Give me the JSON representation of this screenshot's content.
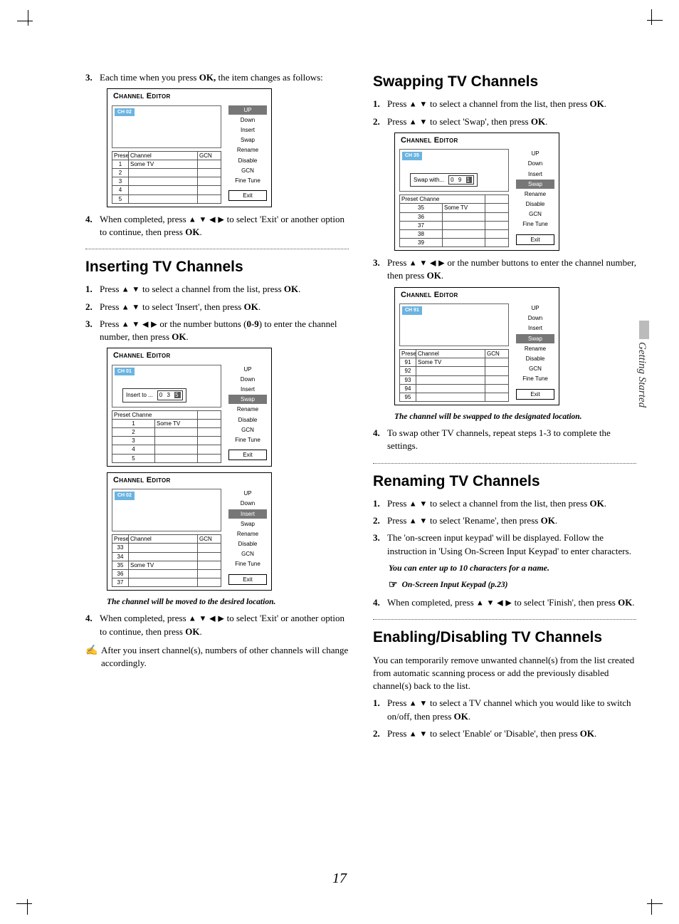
{
  "pageNumber": "17",
  "sideTab": "Getting Started",
  "panelTitle": "Channel Editor",
  "tableHeaders": {
    "preset": "Preset",
    "channel": "Channel",
    "gcn": "GCN"
  },
  "menuItems": [
    "UP",
    "Down",
    "Insert",
    "Swap",
    "Rename",
    "Disable",
    "GCN",
    "Fine Tune"
  ],
  "exitLabel": "Exit",
  "leftCol": {
    "step3": {
      "num": "3.",
      "text_a": "Each time when you press ",
      "ok": "OK,",
      "text_b": "  the item changes as follows:"
    },
    "panel1": {
      "chBadge": "CH 02",
      "rows": [
        [
          "1",
          "Some TV",
          ""
        ],
        [
          "2",
          "",
          ""
        ],
        [
          "3",
          "",
          ""
        ],
        [
          "4",
          "",
          ""
        ],
        [
          "5",
          "",
          ""
        ]
      ],
      "highlight": 0
    },
    "step4": {
      "num": "4.",
      "text_a": "When completed, press ",
      "arrows": "▲ ▼ ◀ ▶",
      "text_b": " to select 'Exit' or another option to continue, then press ",
      "ok": "OK",
      "dot": "."
    },
    "insertingTitle": "Inserting TV Channels",
    "ins_step1": {
      "num": "1.",
      "text_a": "Press ",
      "arrows": "▲ ▼",
      "text_b": " to select a channel from the list, press ",
      "ok": "OK",
      "dot": "."
    },
    "ins_step2": {
      "num": "2.",
      "text_a": "Press ",
      "arrows": "▲ ▼",
      "text_b": " to select 'Insert', then press ",
      "ok": "OK",
      "dot": "."
    },
    "ins_step3": {
      "num": "3.",
      "text_a": "Press ",
      "arrows": "▲ ▼ ◀ ▶",
      "text_b": " or the number buttons (",
      "range": "0-9",
      "text_c": ") to enter the channel number, then press ",
      "ok": "OK",
      "dot": "."
    },
    "panel2": {
      "chBadge": "CH 01",
      "popupLabel": "Insert to ...",
      "popupDigits": [
        "0",
        "3",
        "5"
      ],
      "rows": [
        [
          "1",
          "Some TV",
          ""
        ],
        [
          "2",
          "",
          ""
        ],
        [
          "3",
          "",
          ""
        ],
        [
          "4",
          "",
          ""
        ],
        [
          "5",
          "",
          ""
        ]
      ],
      "highlight": 3,
      "tableHeaderShort": "Preset Channe"
    },
    "panel3": {
      "chBadge": "CH 02",
      "rows": [
        [
          "33",
          "",
          ""
        ],
        [
          "34",
          "",
          ""
        ],
        [
          "35",
          "Some TV",
          ""
        ],
        [
          "36",
          "",
          ""
        ],
        [
          "37",
          "",
          ""
        ]
      ],
      "highlight": 2
    },
    "ins_caption": "The channel will be moved to the desired location.",
    "ins_step4": {
      "num": "4.",
      "text_a": "When completed, press ",
      "arrows": "▲ ▼ ◀ ▶",
      "text_b": " to select 'Exit' or another option to continue, then press ",
      "ok": "OK",
      "dot": "."
    },
    "ins_note": "After you insert channel(s), numbers of other channels will change accordingly."
  },
  "rightCol": {
    "swapTitle": "Swapping TV Channels",
    "sw_step1": {
      "num": "1.",
      "text_a": "Press ",
      "arrows": "▲ ▼",
      "text_b": " to select a channel from the list, then press ",
      "ok": "OK",
      "dot": "."
    },
    "sw_step2": {
      "num": "2.",
      "text_a": "Press ",
      "arrows": "▲ ▼",
      "text_b": " to select 'Swap', then press ",
      "ok": "OK",
      "dot": "."
    },
    "panel4": {
      "chBadge": "CH 35",
      "popupLabel": "Swap with...",
      "popupDigits": [
        "0",
        "9",
        "1"
      ],
      "rows": [
        [
          "35",
          "Some TV",
          ""
        ],
        [
          "36",
          "",
          ""
        ],
        [
          "37",
          "",
          ""
        ],
        [
          "38",
          "",
          ""
        ],
        [
          "39",
          "",
          ""
        ]
      ],
      "highlight": 3,
      "tableHeaderShort": "Preset Channe"
    },
    "sw_step3": {
      "num": "3.",
      "text_a": "Press ",
      "arrows": "▲ ▼ ◀ ▶",
      "text_b": " or the number buttons to enter the channel number, then press ",
      "ok": "OK",
      "dot": "."
    },
    "panel5": {
      "chBadge": "CH 91",
      "rows": [
        [
          "91",
          "Some TV",
          ""
        ],
        [
          "92",
          "",
          ""
        ],
        [
          "93",
          "",
          ""
        ],
        [
          "94",
          "",
          ""
        ],
        [
          "95",
          "",
          ""
        ]
      ],
      "highlight": 3
    },
    "sw_caption": "The channel will be swapped to the designated location.",
    "sw_step4": {
      "num": "4.",
      "text": "To swap other TV channels, repeat steps 1-3 to complete the settings."
    },
    "renameTitle": "Renaming TV Channels",
    "rn_step1": {
      "num": "1.",
      "text_a": "Press ",
      "arrows": "▲ ▼",
      "text_b": " to select a channel from the list, then press ",
      "ok": "OK",
      "dot": "."
    },
    "rn_step2": {
      "num": "2.",
      "text_a": "Press ",
      "arrows": "▲ ▼",
      "text_b": " to select 'Rename', then press ",
      "ok": "OK",
      "dot": "."
    },
    "rn_step3": {
      "num": "3.",
      "text": "The 'on-screen input keypad' will be displayed. Follow the instruction in 'Using On-Screen Input Keypad' to enter characters."
    },
    "rn_note": "You can enter up to 10 characters for a name.",
    "rn_xref": "On-Screen Input Keypad (p.23)",
    "rn_step4": {
      "num": "4.",
      "text_a": "When completed, press ",
      "arrows": "▲ ▼ ◀ ▶",
      "text_b": " to select 'Finish', then press ",
      "ok": "OK",
      "dot": "."
    },
    "enableTitle": "Enabling/Disabling TV Channels",
    "en_intro": "You can temporarily remove unwanted channel(s) from the list created from automatic scanning process or add the previously disabled channel(s) back to the list.",
    "en_step1": {
      "num": "1.",
      "text_a": "Press ",
      "arrows": "▲ ▼",
      "text_b": " to select a TV channel which you would like to switch on/off, then press ",
      "ok": "OK",
      "dot": "."
    },
    "en_step2": {
      "num": "2.",
      "text_a": "Press ",
      "arrows": "▲ ▼",
      "text_b": " to select 'Enable' or 'Disable', then press ",
      "ok": "OK",
      "dot": "."
    }
  }
}
